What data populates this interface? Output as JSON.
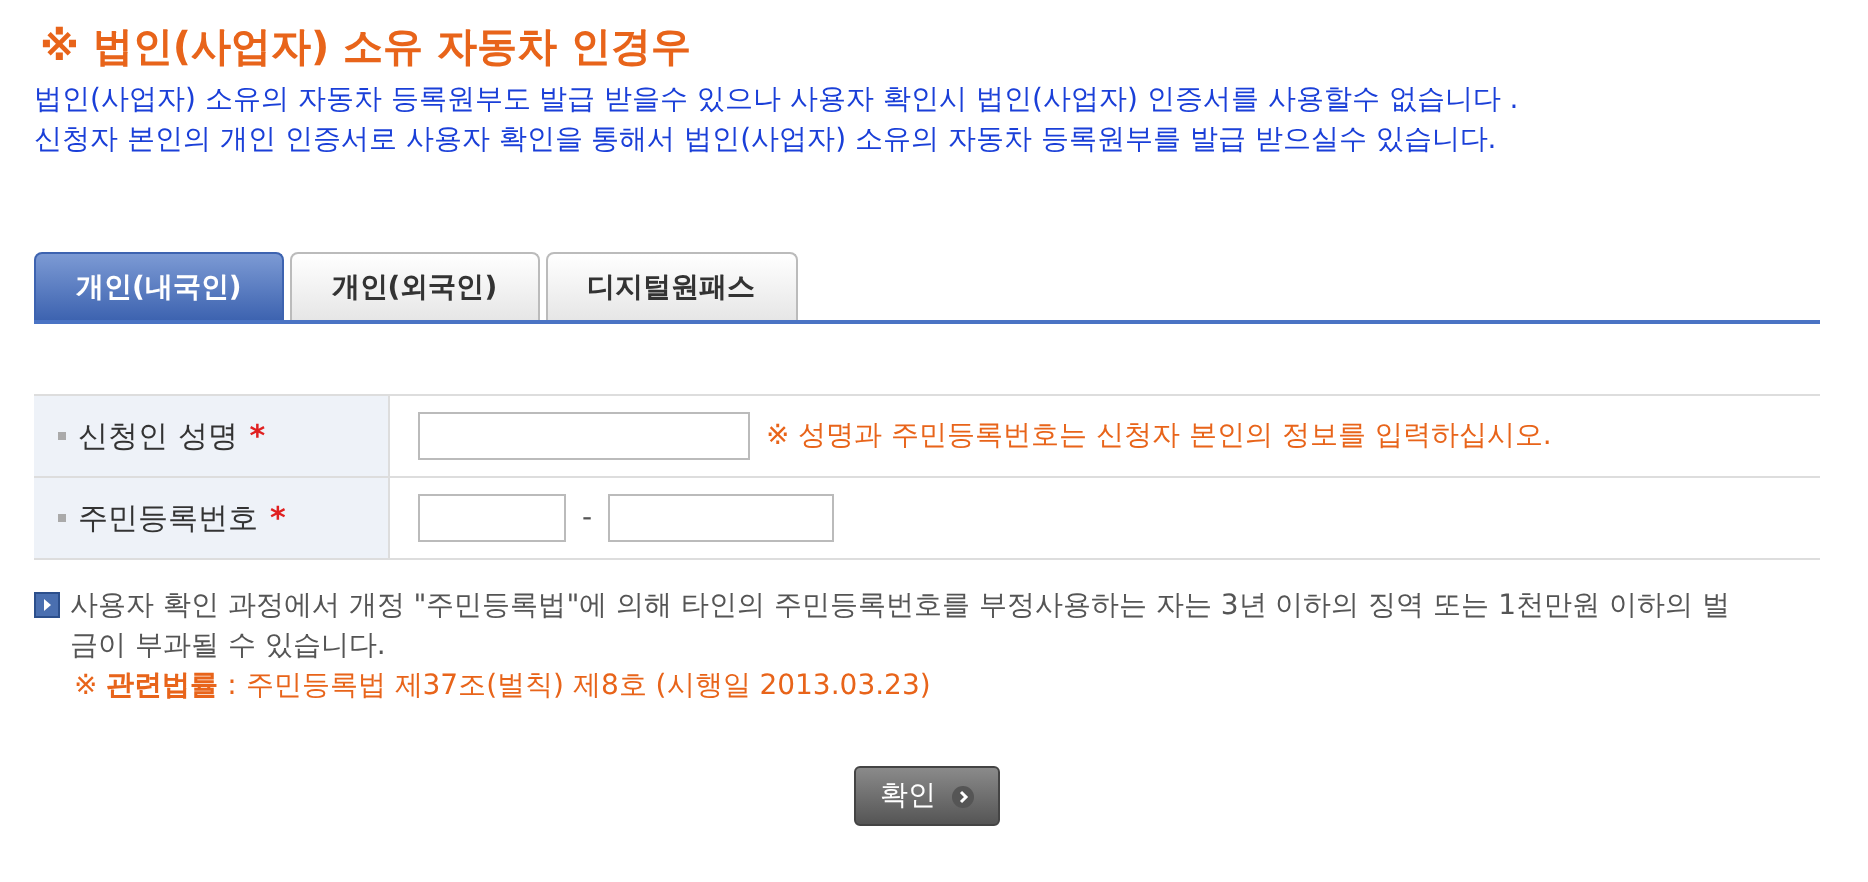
{
  "title": "※ 법인(사업자) 소유 자동차 인경우",
  "intro": [
    "법인(사업자) 소유의 자동차 등록원부도 발급 받을수 있으나 사용자 확인시 법인(사업자) 인증서를 사용할수 없습니다 .",
    "신청자 본인의 개인 인증서로 사용자 확인을 통해서 법인(사업자) 소유의 자동차 등록원부를 발급 받으실수 있습니다."
  ],
  "tabs": [
    {
      "label": "개인(내국인)",
      "selected": true
    },
    {
      "label": "개인(외국인)",
      "selected": false
    },
    {
      "label": "디지털원패스",
      "selected": false
    }
  ],
  "form": {
    "rows": [
      {
        "kind": "name",
        "label": "신청인 성명",
        "required_mark": "*",
        "note": "※ 성명과 주민등록번호는 신청자 본인의 정보를 입력하십시오."
      },
      {
        "kind": "rrn",
        "label": "주민등록번호",
        "required_mark": "*",
        "separator": "-"
      }
    ]
  },
  "notice": "사용자 확인 과정에서 개정 \"주민등록법\"에 의해 타인의 주민등록번호를 부정사용하는 자는 3년 이하의 징역 또는 1천만원 이하의 벌금이 부과될 수 있습니다.",
  "law": "※ **관련법률** : 주민등록법 제37조(벌칙) 제8호 (시행일 2013.03.23)",
  "button": "확인"
}
